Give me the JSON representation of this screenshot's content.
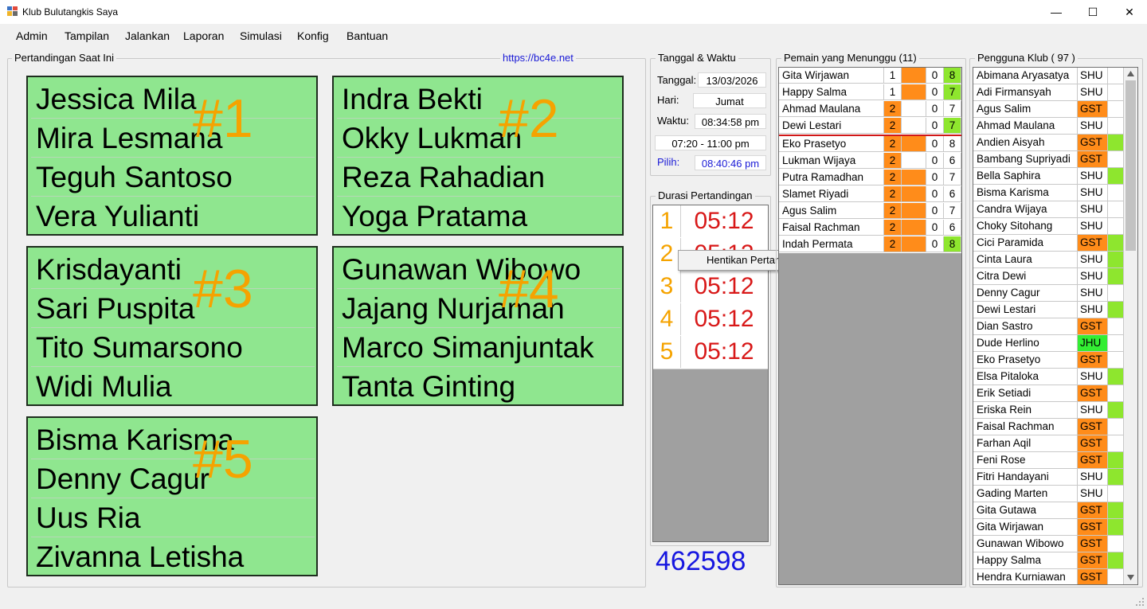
{
  "window": {
    "title": "Klub Bulutangkis Saya",
    "controls": {
      "minimize": "—",
      "maximize": "☐",
      "close": "✕"
    }
  },
  "menu": [
    "Admin",
    "Tampilan",
    "Jalankan",
    "Laporan",
    "Simulasi",
    "Konfig",
    "Bantuan"
  ],
  "matches": {
    "title": "Pertandingan Saat Ini",
    "link": "https://bc4e.net",
    "courts": [
      {
        "number": "#1",
        "players": [
          "Jessica Mila",
          "Mira Lesmana",
          "Teguh Santoso",
          "Vera Yulianti"
        ]
      },
      {
        "number": "#2",
        "players": [
          "Indra Bekti",
          "Okky Lukman",
          "Reza Rahadian",
          "Yoga Pratama"
        ]
      },
      {
        "number": "#3",
        "players": [
          "Krisdayanti",
          "Sari Puspita",
          "Tito Sumarsono",
          "Widi Mulia"
        ]
      },
      {
        "number": "#4",
        "players": [
          "Gunawan Wibowo",
          "Jajang Nurjaman",
          "Marco Simanjuntak",
          "Tanta Ginting"
        ]
      },
      {
        "number": "#5",
        "players": [
          "Bisma Karisma",
          "Denny Cagur",
          "Uus Ria",
          "Zivanna Letisha"
        ]
      }
    ]
  },
  "datetime": {
    "title": "Tanggal & Waktu",
    "date_label": "Tanggal:",
    "date": "13/03/2026",
    "day_label": "Hari:",
    "day": "Jumat",
    "time_label": "Waktu:",
    "time": "08:34:58 pm",
    "range": "07:20 - 11:00 pm",
    "pick_label": "Pilih:",
    "pick_time": "08:40:46 pm"
  },
  "durations": {
    "title": "Durasi Pertandingan",
    "items": [
      {
        "court": "1",
        "time": "05:12"
      },
      {
        "court": "2",
        "time": "05:12"
      },
      {
        "court": "3",
        "time": "05:12"
      },
      {
        "court": "4",
        "time": "05:12"
      },
      {
        "court": "5",
        "time": "05:12"
      }
    ],
    "context_menu_item": "Hentikan Pertandingan",
    "counter": "462598"
  },
  "waiting": {
    "title": "Pemain yang Menunggu (11)",
    "players": [
      {
        "name": "Gita Wirjawan",
        "c1": "1",
        "c2": "0",
        "c3": "8"
      },
      {
        "name": "Happy Salma",
        "c1": "1",
        "c2": "0",
        "c3": "7"
      },
      {
        "name": "Ahmad Maulana",
        "c1": "2",
        "c2": "0",
        "c3": "7"
      },
      {
        "name": "Dewi Lestari",
        "c1": "2",
        "c2": "0",
        "c3": "7"
      },
      {
        "name": "Eko Prasetyo",
        "c1": "2",
        "c2": "0",
        "c3": "8"
      },
      {
        "name": "Lukman Wijaya",
        "c1": "2",
        "c2": "0",
        "c3": "6"
      },
      {
        "name": "Putra Ramadhan",
        "c1": "2",
        "c2": "0",
        "c3": "7"
      },
      {
        "name": "Slamet Riyadi",
        "c1": "2",
        "c2": "0",
        "c3": "6"
      },
      {
        "name": "Agus Salim",
        "c1": "2",
        "c2": "0",
        "c3": "7"
      },
      {
        "name": "Faisal Rachman",
        "c1": "2",
        "c2": "0",
        "c3": "6"
      },
      {
        "name": "Indah Permata",
        "c1": "2",
        "c2": "0",
        "c3": "8"
      }
    ]
  },
  "users": {
    "title": "Pengguna Klub ( 97 )",
    "list": [
      {
        "name": "Abimana Aryasatya",
        "status": "SHU"
      },
      {
        "name": "Adi Firmansyah",
        "status": "SHU"
      },
      {
        "name": "Agus Salim",
        "status": "GST"
      },
      {
        "name": "Ahmad Maulana",
        "status": "SHU"
      },
      {
        "name": "Andien Aisyah",
        "status": "GST"
      },
      {
        "name": "Bambang Supriyadi",
        "status": "GST"
      },
      {
        "name": "Bella Saphira",
        "status": "SHU"
      },
      {
        "name": "Bisma Karisma",
        "status": "SHU"
      },
      {
        "name": "Candra Wijaya",
        "status": "SHU"
      },
      {
        "name": "Choky Sitohang",
        "status": "SHU"
      },
      {
        "name": "Cici Paramida",
        "status": "GST"
      },
      {
        "name": "Cinta Laura",
        "status": "SHU"
      },
      {
        "name": "Citra Dewi",
        "status": "SHU"
      },
      {
        "name": "Denny Cagur",
        "status": "SHU"
      },
      {
        "name": "Dewi Lestari",
        "status": "SHU"
      },
      {
        "name": "Dian Sastro",
        "status": "GST"
      },
      {
        "name": "Dude Herlino",
        "status": "JHU"
      },
      {
        "name": "Eko Prasetyo",
        "status": "GST"
      },
      {
        "name": "Elsa Pitaloka",
        "status": "SHU"
      },
      {
        "name": "Erik Setiadi",
        "status": "GST"
      },
      {
        "name": "Eriska Rein",
        "status": "SHU"
      },
      {
        "name": "Faisal Rachman",
        "status": "GST"
      },
      {
        "name": "Farhan Aqil",
        "status": "GST"
      },
      {
        "name": "Feni Rose",
        "status": "GST"
      },
      {
        "name": "Fitri Handayani",
        "status": "SHU"
      },
      {
        "name": "Gading Marten",
        "status": "SHU"
      },
      {
        "name": "Gita Gutawa",
        "status": "GST"
      },
      {
        "name": "Gita Wirjawan",
        "status": "GST"
      },
      {
        "name": "Gunawan Wibowo",
        "status": "GST"
      },
      {
        "name": "Happy Salma",
        "status": "GST"
      },
      {
        "name": "Hendra Kurniawan",
        "status": "GST"
      }
    ]
  },
  "colors": {
    "court_bg": "#8fe68f",
    "court_number": "#f5a300",
    "orange_cell": "#ff8c1a",
    "green_cell": "#8ee62e",
    "lime_cell": "#33ee33",
    "timer_red": "#d81818",
    "counter_blue": "#1616e0",
    "link_blue": "#1a1ad6"
  }
}
